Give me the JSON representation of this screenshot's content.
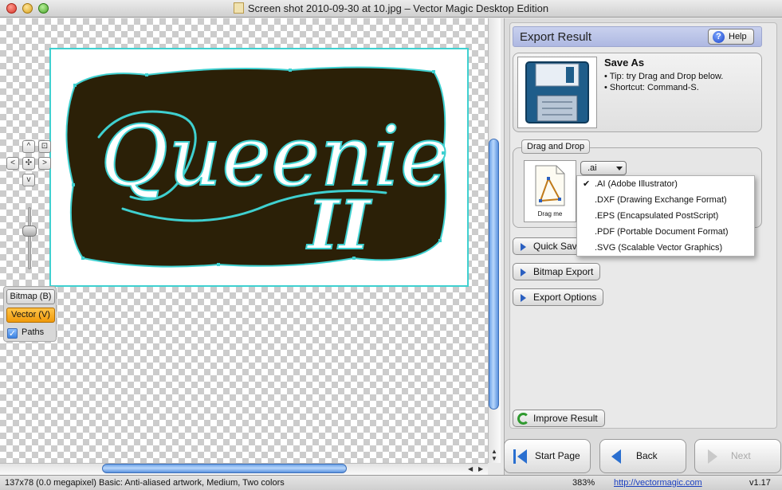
{
  "window": {
    "title": "Screen shot 2010-09-30 at 10.jpg – Vector Magic Desktop Edition"
  },
  "artwork": {
    "word": "Queenie",
    "numeral": "II",
    "background_color": "#2b2007",
    "outline_color": "#3fd0d0"
  },
  "nav_pad": {
    "up": "^",
    "down": "v",
    "left": "<",
    "right": ">"
  },
  "view_panel": {
    "bitmap_label": "Bitmap (B)",
    "vector_label": "Vector (V)",
    "paths_label": "Paths",
    "paths_checked": true
  },
  "export_panel": {
    "title": "Export Result",
    "help_label": "Help",
    "save_as": {
      "title": "Save As",
      "tip1": "• Tip: try Drag and Drop below.",
      "tip2": "• Shortcut: Command-S."
    },
    "drag_and_drop": {
      "label": "Drag and Drop",
      "drag_me": "Drag me",
      "selected_format": ".ai",
      "options": [
        ".AI (Adobe Illustrator)",
        ".DXF (Drawing Exchange Format)",
        ".EPS (Encapsulated PostScript)",
        ".PDF (Portable Document Format)",
        ".SVG (Scalable Vector Graphics)"
      ]
    },
    "quick_save_label": "Quick Save",
    "bitmap_export_label": "Bitmap Export",
    "export_options_label": "Export Options",
    "improve_result_label": "Improve Result"
  },
  "bottom_nav": {
    "start_page": "Start Page",
    "back": "Back",
    "next": "Next"
  },
  "status": {
    "info": "137x78 (0.0 megapixel)  Basic: Anti-aliased artwork, Medium, Two colors",
    "zoom": "383%",
    "link": "http://vectormagic.com",
    "version": "v1.17"
  }
}
